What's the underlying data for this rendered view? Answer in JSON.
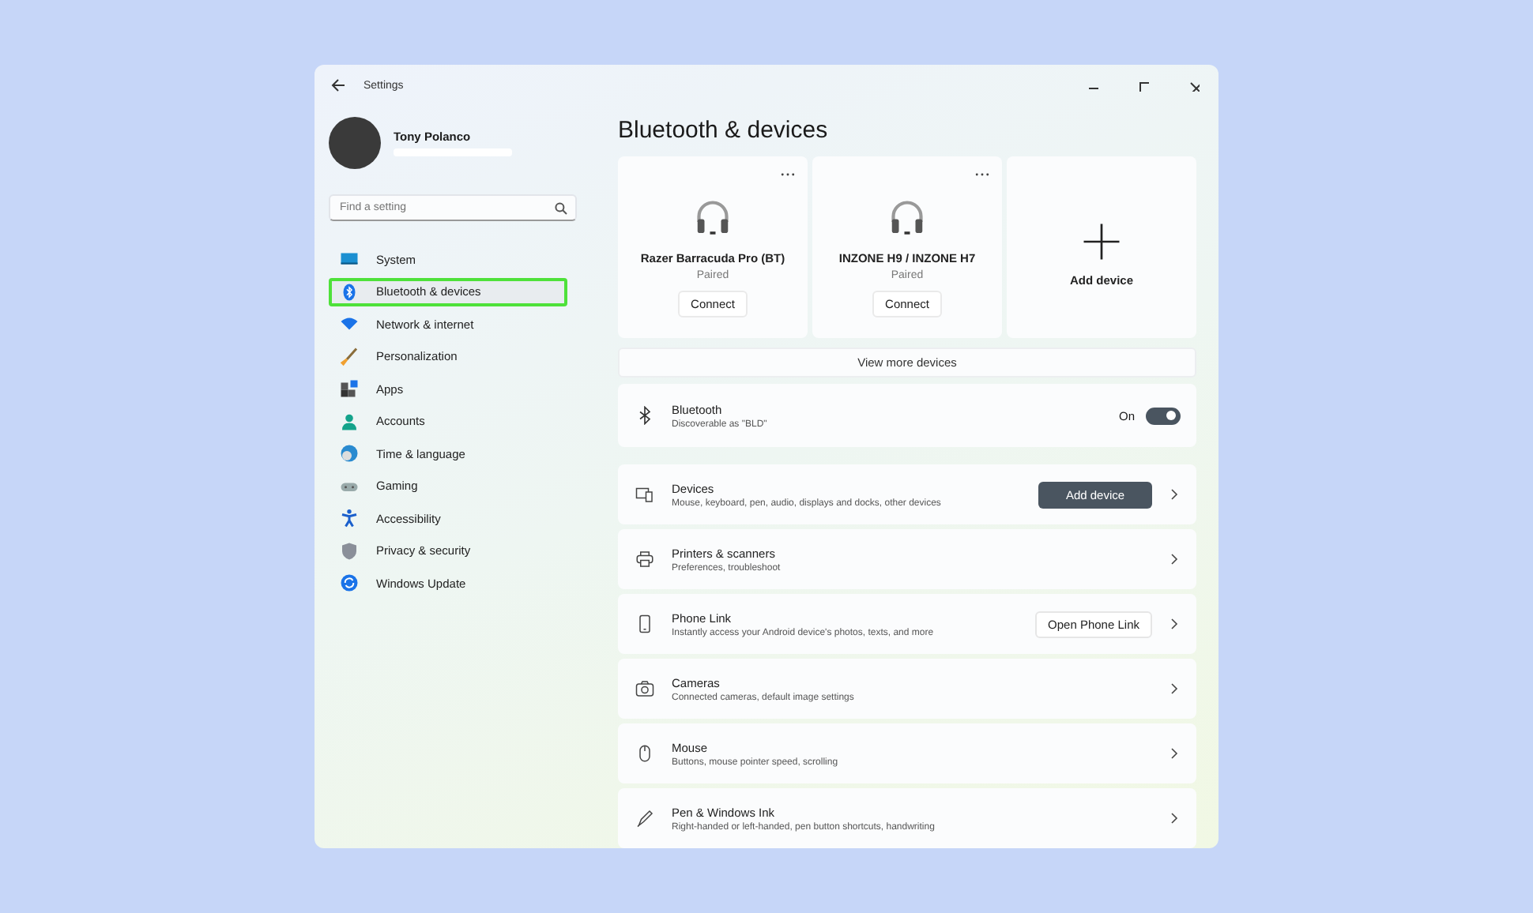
{
  "window": {
    "title": "Settings"
  },
  "profile": {
    "name": "Tony Polanco"
  },
  "search": {
    "placeholder": "Find a setting"
  },
  "nav": [
    {
      "label": "System",
      "selected": false
    },
    {
      "label": "Bluetooth & devices",
      "selected": true
    },
    {
      "label": "Network & internet",
      "selected": false
    },
    {
      "label": "Personalization",
      "selected": false
    },
    {
      "label": "Apps",
      "selected": false
    },
    {
      "label": "Accounts",
      "selected": false
    },
    {
      "label": "Time & language",
      "selected": false
    },
    {
      "label": "Gaming",
      "selected": false
    },
    {
      "label": "Accessibility",
      "selected": false
    },
    {
      "label": "Privacy & security",
      "selected": false
    },
    {
      "label": "Windows Update",
      "selected": false
    }
  ],
  "page_title": "Bluetooth & devices",
  "device_cards": [
    {
      "kind": "device",
      "name": "Razer Barracuda Pro (BT)",
      "status": "Paired",
      "button": "Connect"
    },
    {
      "kind": "device",
      "name": "INZONE H9 / INZONE H7",
      "status": "Paired",
      "button": "Connect"
    },
    {
      "kind": "add",
      "name": "Add device"
    }
  ],
  "view_more": "View more devices",
  "bluetooth": {
    "title": "Bluetooth",
    "subtitle": "Discoverable as \"BLD\"",
    "state_label": "On",
    "on": true
  },
  "rows": [
    {
      "title": "Devices",
      "subtitle": "Mouse, keyboard, pen, audio, displays and docks, other devices",
      "action": {
        "label": "Add device",
        "kind": "primary"
      }
    },
    {
      "title": "Printers & scanners",
      "subtitle": "Preferences, troubleshoot"
    },
    {
      "title": "Phone Link",
      "subtitle": "Instantly access your Android device's photos, texts, and more",
      "action": {
        "label": "Open Phone Link",
        "kind": "secondary"
      }
    },
    {
      "title": "Cameras",
      "subtitle": "Connected cameras, default image settings"
    },
    {
      "title": "Mouse",
      "subtitle": "Buttons, mouse pointer speed, scrolling"
    },
    {
      "title": "Pen & Windows Ink",
      "subtitle": "Right-handed or left-handed, pen button shortcuts, handwriting"
    }
  ]
}
